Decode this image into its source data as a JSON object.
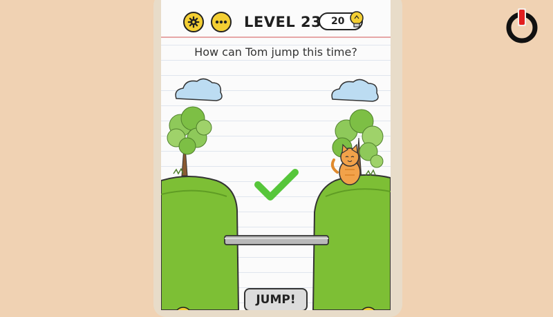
{
  "header": {
    "level_label": "LEVEL 238",
    "hint_count": "20"
  },
  "question": "How can Tom jump this time?",
  "action": {
    "jump_label": "JUMP!"
  },
  "icons": {
    "settings": "gear-icon",
    "menu": "more-dots-icon",
    "hint": "lightbulb-icon",
    "overlay": "power-icon",
    "result": "checkmark-icon"
  },
  "colors": {
    "background": "#f0d2b3",
    "button_yellow": "#f4cf33",
    "grass": "#7dbf35",
    "check": "#56c63a",
    "cat": "#f2a24a"
  }
}
